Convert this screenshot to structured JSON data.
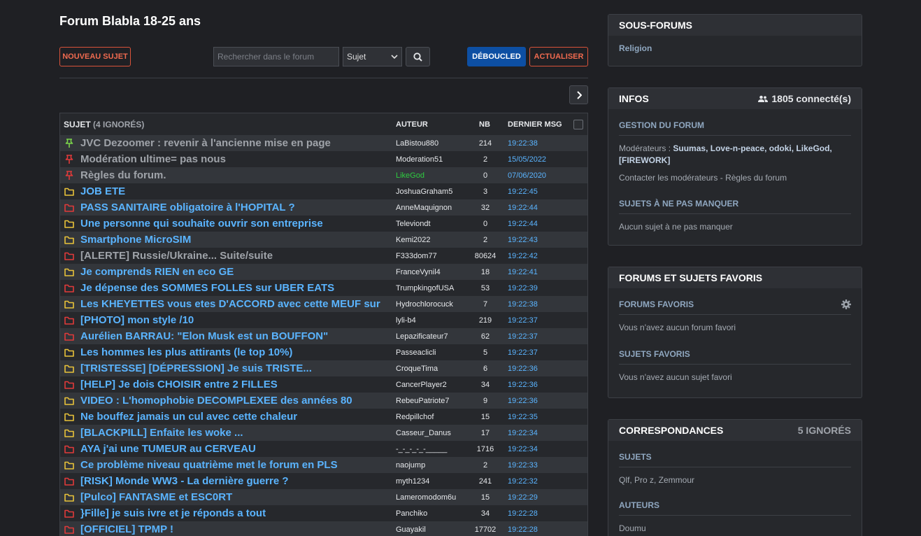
{
  "forum": {
    "title": "Forum Blabla 18-25 ans"
  },
  "toolbar": {
    "new_topic": "Nouveau sujet",
    "search_placeholder": "Rechercher dans le forum",
    "search_scope": "Sujet",
    "unbuckled": "Déboucled",
    "refresh": "Actualiser"
  },
  "table": {
    "headers": {
      "subject": "Sujet",
      "ignored": "(4 ignorés)",
      "author": "Auteur",
      "nb": "NB",
      "last": "Dernier msg"
    },
    "rows": [
      {
        "icon": "pin-green",
        "subject": "JVC Dezoomer : revenir à l'ancienne mise en page",
        "subject_color": "grey",
        "author": "LaBistou880",
        "nb": "214",
        "last": "19:22:38"
      },
      {
        "icon": "pin-red",
        "subject": "Modération ultime= pas nous",
        "subject_color": "grey",
        "author": "Moderation51",
        "nb": "2",
        "last": "15/05/2022"
      },
      {
        "icon": "pin-red",
        "subject": "Règles du forum.",
        "subject_color": "grey",
        "author": "LikeGod",
        "author_color": "green",
        "nb": "0",
        "last": "07/06/2020"
      },
      {
        "icon": "folder-yellow",
        "subject": "JOB ETE",
        "subject_color": "blue",
        "author": "JoshuaGraham5",
        "nb": "3",
        "last": "19:22:45"
      },
      {
        "icon": "folder-red",
        "subject": "PASS SANITAIRE obligatoire à l'HOPITAL ?",
        "subject_color": "blue",
        "author": "AnneMaquignon",
        "nb": "32",
        "last": "19:22:44"
      },
      {
        "icon": "folder-yellow",
        "subject": "Une personne qui souhaite ouvrir son entreprise",
        "subject_color": "blue",
        "author": "Televiondt",
        "nb": "0",
        "last": "19:22:44"
      },
      {
        "icon": "folder-yellow",
        "subject": "Smartphone MicroSIM",
        "subject_color": "blue",
        "author": "Kemi2022",
        "nb": "2",
        "last": "19:22:43"
      },
      {
        "icon": "folder-red",
        "subject": "[ALERTE] Russie/Ukraine... Suite/suite",
        "subject_color": "grey",
        "author": "F333dom77",
        "nb": "80624",
        "last": "19:22:42"
      },
      {
        "icon": "folder-yellow",
        "subject": "Je comprends RIEN en eco GE",
        "subject_color": "blue",
        "author": "FranceVynil4",
        "nb": "18",
        "last": "19:22:41"
      },
      {
        "icon": "folder-red",
        "subject": "Je dépense des SOMMES FOLLES sur UBER EATS",
        "subject_color": "blue",
        "author": "TrumpkingofUSA",
        "nb": "53",
        "last": "19:22:39"
      },
      {
        "icon": "folder-yellow",
        "subject": "Les KHEYETTES vous etes D'ACCORD avec cette MEUF sur",
        "subject_color": "blue",
        "author": "Hydrochlorocuck",
        "nb": "7",
        "last": "19:22:38"
      },
      {
        "icon": "folder-red",
        "subject": "[PHOTO] mon style /10",
        "subject_color": "blue",
        "author": "lyli-b4",
        "nb": "219",
        "last": "19:22:37"
      },
      {
        "icon": "folder-red",
        "subject": "Aurélien BARRAU: \"Elon Musk est un BOUFFON\"",
        "subject_color": "blue",
        "author": "Lepazificateur7",
        "nb": "62",
        "last": "19:22:37"
      },
      {
        "icon": "folder-yellow",
        "subject": "Les hommes les plus attirants (le top 10%)",
        "subject_color": "blue",
        "author": "Passeaclicli",
        "nb": "5",
        "last": "19:22:37"
      },
      {
        "icon": "folder-yellow",
        "subject": "[TRISTESSE] [DÉPRESSION] Je suis TRISTE...",
        "subject_color": "blue",
        "author": "CroqueTima",
        "nb": "6",
        "last": "19:22:36"
      },
      {
        "icon": "folder-red",
        "subject": "[HELP] Je dois CHOISIR entre 2 FILLES",
        "subject_color": "blue",
        "author": "CancerPlayer2",
        "nb": "34",
        "last": "19:22:36"
      },
      {
        "icon": "folder-yellow",
        "subject": "VIDEO : L'homophobie DECOMPLEXEE des années 80",
        "subject_color": "blue",
        "author": "RebeuPatriote7",
        "nb": "9",
        "last": "19:22:36"
      },
      {
        "icon": "folder-yellow",
        "subject": "Ne bouffez jamais un cul avec cette chaleur",
        "subject_color": "blue",
        "author": "Redpillchof",
        "nb": "15",
        "last": "19:22:35"
      },
      {
        "icon": "folder-yellow",
        "subject": "[BLACKPILL] Enfaite les woke ...",
        "subject_color": "blue",
        "author": "Casseur_Danus",
        "nb": "17",
        "last": "19:22:34"
      },
      {
        "icon": "folder-red",
        "subject": "AYA j'ai une TUMEUR au CERVEAU",
        "subject_color": "blue",
        "author": "-_-_-_-_-_____",
        "nb": "1716",
        "last": "19:22:34"
      },
      {
        "icon": "folder-yellow",
        "subject": "Ce problème niveau quatrième met le forum en PLS",
        "subject_color": "blue",
        "author": "naojump",
        "nb": "2",
        "last": "19:22:33"
      },
      {
        "icon": "folder-red",
        "subject": "[RISK] Monde WW3 - La dernière guerre ?",
        "subject_color": "blue",
        "author": "myth1234",
        "nb": "241",
        "last": "19:22:32"
      },
      {
        "icon": "folder-yellow",
        "subject": "[Pulco] FANTASME et ESC0RT",
        "subject_color": "blue",
        "author": "Lameromodom6u",
        "nb": "15",
        "last": "19:22:29"
      },
      {
        "icon": "folder-red",
        "subject": "}Fille] je suis ivre et je réponds a tout",
        "subject_color": "blue",
        "author": "Panchiko",
        "nb": "34",
        "last": "19:22:28"
      },
      {
        "icon": "folder-red",
        "subject": "[OFFICIEL] TPMP !",
        "subject_color": "blue",
        "author": "Guayakil",
        "nb": "17702",
        "last": "19:22:28"
      }
    ]
  },
  "sidebar": {
    "subforums": {
      "title": "Sous-forums",
      "items": [
        "Religion"
      ]
    },
    "infos": {
      "title": "Infos",
      "connected": "1805 connecté(s)",
      "management_title": "Gestion du forum",
      "moderators_label": "Modérateurs :",
      "moderators": "Suumas, Love-n-peace, odoki, LikeGod, [FIREWORK]",
      "contact": "Contacter les modérateurs - Règles du forum",
      "must_see_title": "Sujets à ne pas manquer",
      "must_see_text": "Aucun sujet à ne pas manquer"
    },
    "favorites": {
      "title": "Forums et sujets favoris",
      "forums_title": "Forums favoris",
      "forums_text": "Vous n'avez aucun forum favori",
      "topics_title": "Sujets favoris",
      "topics_text": "Vous n'avez aucun sujet favori"
    },
    "matches": {
      "title": "Correspondances",
      "ignored": "5 ignorés",
      "subjects_title": "Sujets",
      "subjects": "Qlf,  Pro z,  Zemmour",
      "authors_title": "Auteurs",
      "authors": "Doumu"
    }
  },
  "colors": {
    "background": "#1f2024",
    "accent_red": "#f06a4f",
    "accent_blue": "#0d4fa3",
    "link_blue": "#5ab4ff",
    "folder_yellow": "#e8c23a",
    "folder_red": "#e03a3a",
    "pin_green": "#7bd34a"
  }
}
